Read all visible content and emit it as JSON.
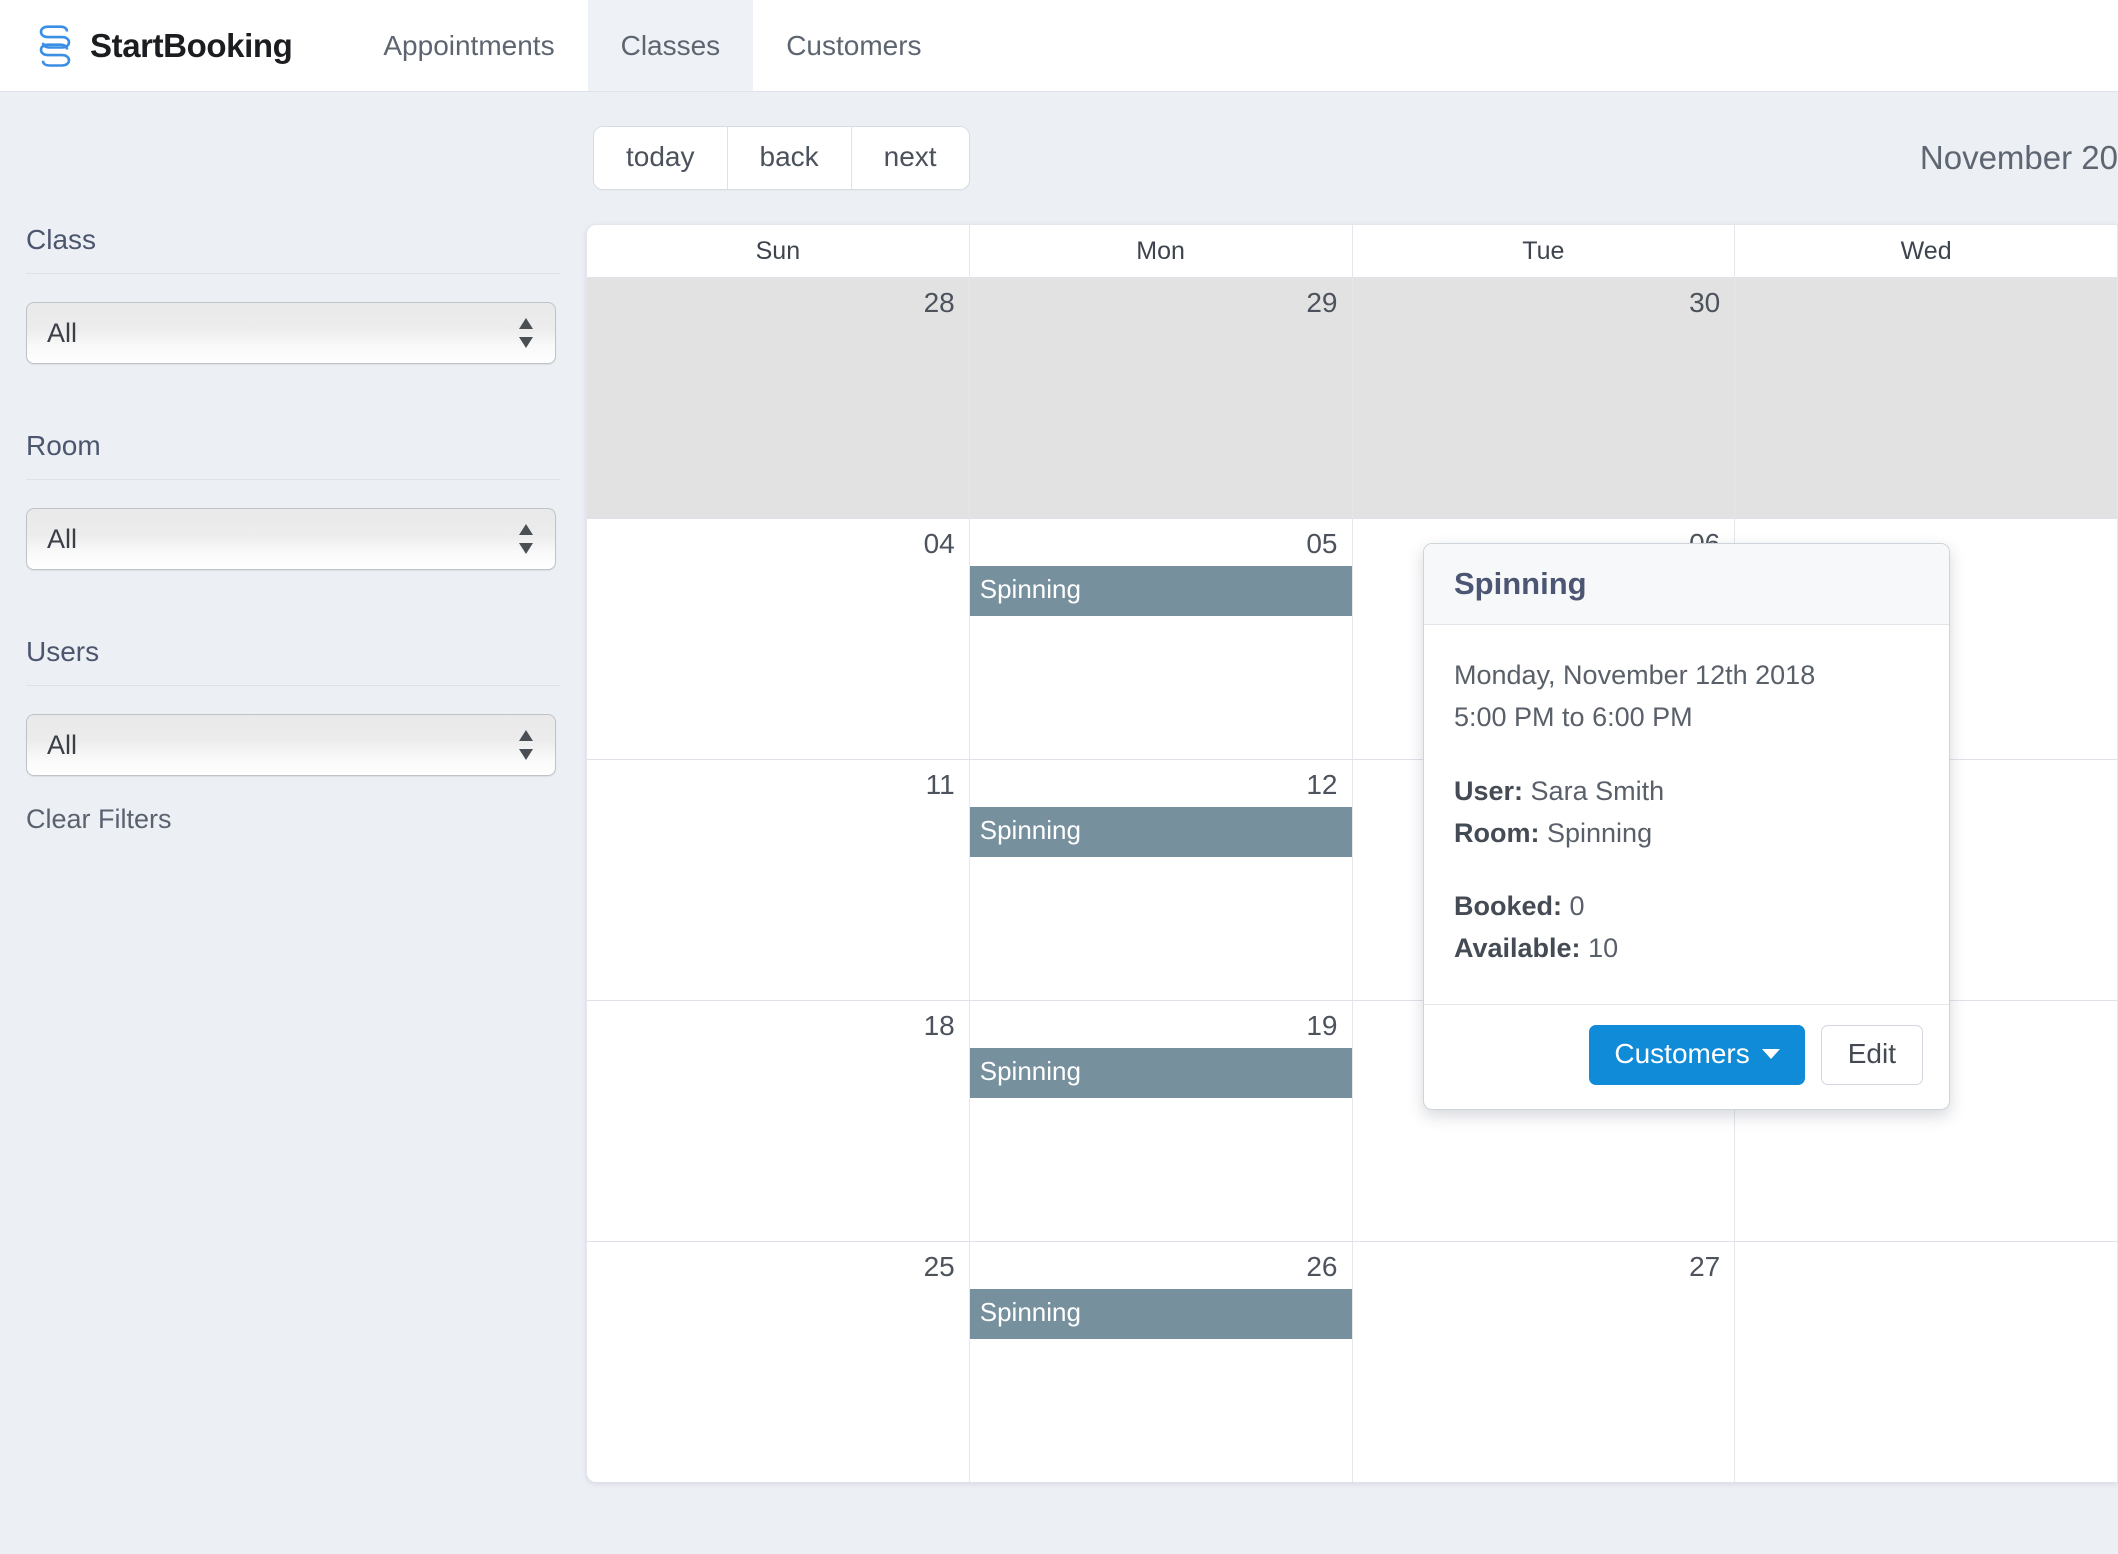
{
  "brand": {
    "name": "StartBooking",
    "logo_icon": "startbooking-s-logo",
    "logo_color": "#2f8ce0"
  },
  "nav": {
    "items": [
      {
        "label": "Appointments",
        "active": false
      },
      {
        "label": "Classes",
        "active": true
      },
      {
        "label": "Customers",
        "active": false
      }
    ]
  },
  "sidebar": {
    "filters": [
      {
        "label": "Class",
        "value": "All",
        "name": "class"
      },
      {
        "label": "Room",
        "value": "All",
        "name": "room"
      },
      {
        "label": "Users",
        "value": "All",
        "name": "users"
      }
    ],
    "clear_filters_label": "Clear Filters"
  },
  "toolbar": {
    "today_label": "today",
    "back_label": "back",
    "next_label": "next",
    "title": "November 20"
  },
  "calendar": {
    "weekday_headers": [
      "Sun",
      "Mon",
      "Tue",
      "Wed"
    ],
    "event_color": "#77909e",
    "past_day_color": "#e2e2e2",
    "rows": [
      {
        "days": [
          {
            "num": "28",
            "past": true,
            "events": []
          },
          {
            "num": "29",
            "past": true,
            "events": []
          },
          {
            "num": "30",
            "past": true,
            "events": []
          },
          {
            "num": "",
            "past": true,
            "events": []
          }
        ]
      },
      {
        "days": [
          {
            "num": "04",
            "past": false,
            "events": []
          },
          {
            "num": "05",
            "past": false,
            "events": [
              {
                "title": "Spinning"
              }
            ]
          },
          {
            "num": "06",
            "past": false,
            "events": []
          },
          {
            "num": "",
            "past": false,
            "events": []
          }
        ]
      },
      {
        "days": [
          {
            "num": "11",
            "past": false,
            "events": []
          },
          {
            "num": "12",
            "past": false,
            "events": [
              {
                "title": "Spinning"
              }
            ]
          },
          {
            "num": "",
            "past": false,
            "events": []
          },
          {
            "num": "",
            "past": false,
            "events": []
          }
        ]
      },
      {
        "days": [
          {
            "num": "18",
            "past": false,
            "events": []
          },
          {
            "num": "19",
            "past": false,
            "events": [
              {
                "title": "Spinning"
              }
            ]
          },
          {
            "num": "",
            "past": false,
            "events": []
          },
          {
            "num": "",
            "past": false,
            "events": []
          }
        ]
      },
      {
        "days": [
          {
            "num": "25",
            "past": false,
            "events": []
          },
          {
            "num": "26",
            "past": false,
            "events": [
              {
                "title": "Spinning"
              }
            ]
          },
          {
            "num": "27",
            "past": false,
            "events": []
          },
          {
            "num": "",
            "past": false,
            "events": []
          }
        ]
      }
    ]
  },
  "popover": {
    "title": "Spinning",
    "date": "Monday, November 12th 2018",
    "time": "5:00 PM to 6:00 PM",
    "user_label": "User:",
    "user_value": "Sara Smith",
    "room_label": "Room:",
    "room_value": "Spinning",
    "booked_label": "Booked:",
    "booked_value": "0",
    "available_label": "Available:",
    "available_value": "10",
    "customers_button": "Customers",
    "edit_button": "Edit",
    "primary_color": "#0f8bd8"
  }
}
